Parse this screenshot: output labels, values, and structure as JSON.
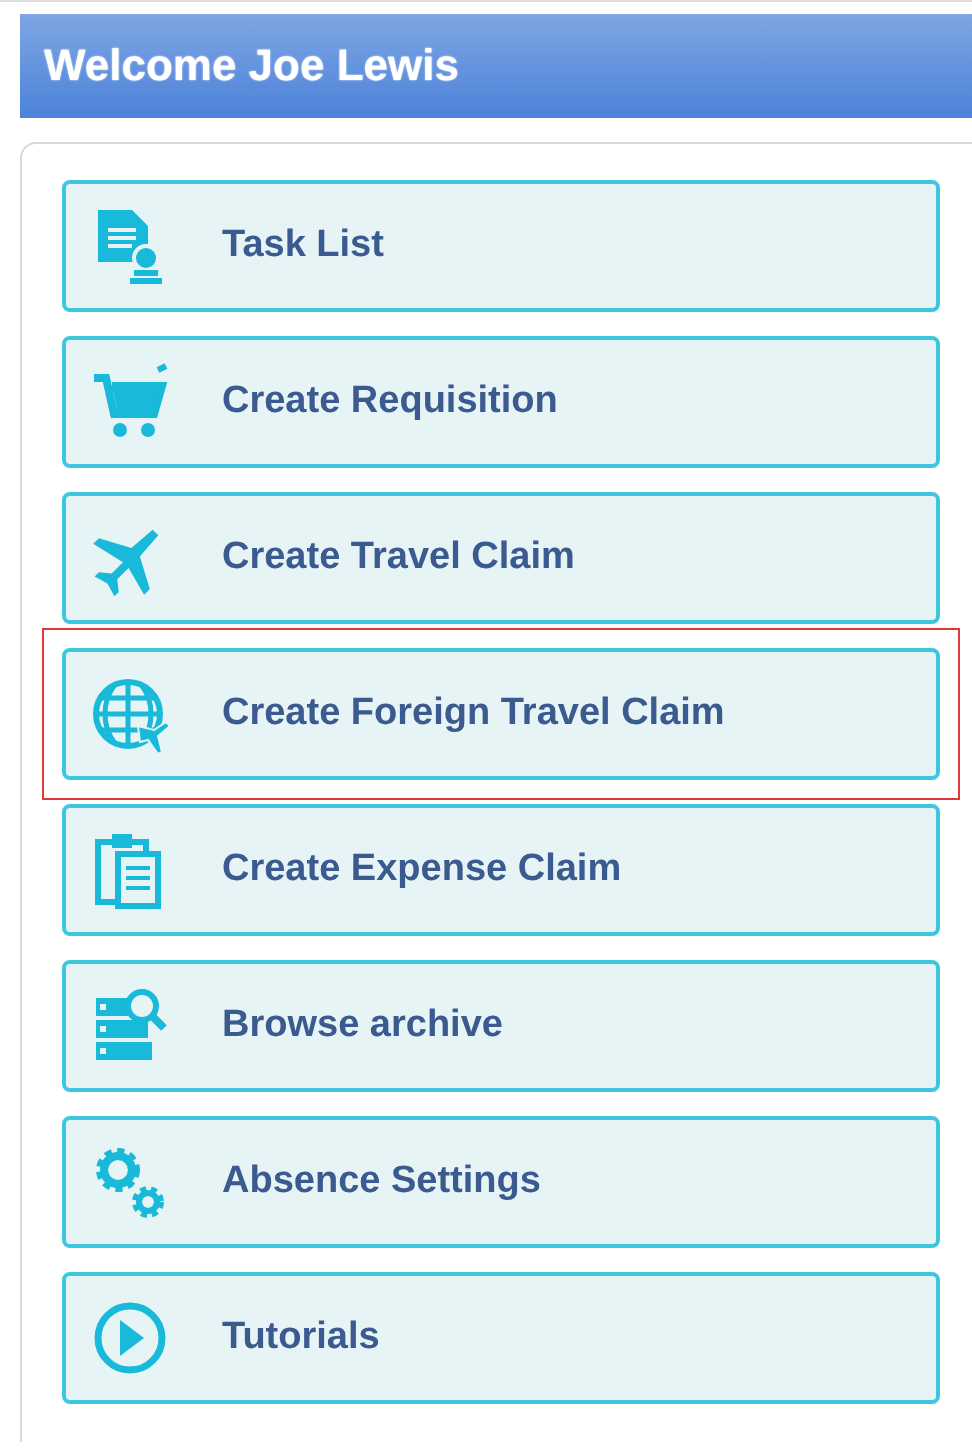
{
  "header": {
    "title": "Welcome Joe Lewis"
  },
  "menu": [
    {
      "label": "Task List",
      "kind": "document",
      "highlighted": false
    },
    {
      "label": "Create Requisition",
      "kind": "cart",
      "highlighted": false
    },
    {
      "label": "Create Travel Claim",
      "kind": "plane",
      "highlighted": false
    },
    {
      "label": "Create Foreign Travel Claim",
      "kind": "globe",
      "highlighted": true
    },
    {
      "label": "Create Expense Claim",
      "kind": "clipboard",
      "highlighted": false
    },
    {
      "label": "Browse archive",
      "kind": "archive",
      "highlighted": false
    },
    {
      "label": "Absence Settings",
      "kind": "gears",
      "highlighted": false
    },
    {
      "label": "Tutorials",
      "kind": "play",
      "highlighted": false
    }
  ]
}
